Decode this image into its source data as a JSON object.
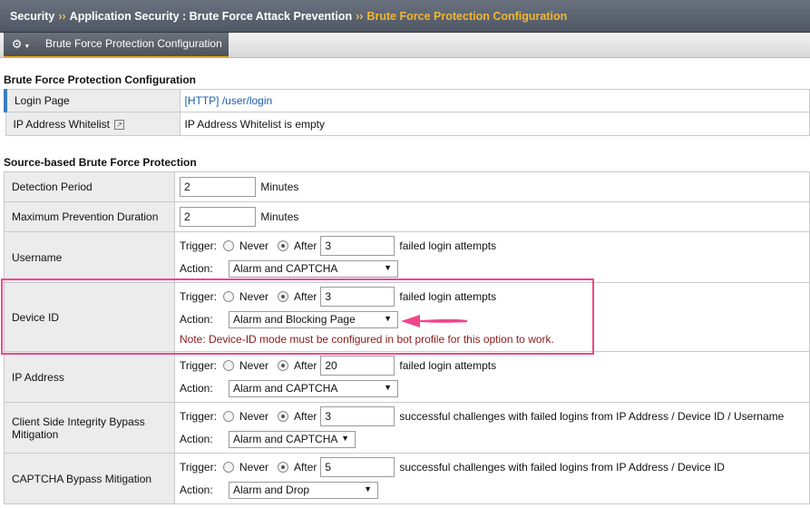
{
  "breadcrumb": {
    "items": [
      "Security",
      "Application Security : Brute Force Attack Prevention",
      "Brute Force Protection Configuration"
    ],
    "separator": "››"
  },
  "toolbar": {
    "gear_icon": "gear-icon",
    "active_tab": "Brute Force Protection Configuration"
  },
  "config_section": {
    "title": "Brute Force Protection Configuration",
    "rows": [
      {
        "label": "Login Page",
        "value": "[HTTP] /user/login"
      },
      {
        "label": "IP Address Whitelist",
        "value": "IP Address Whitelist is empty"
      }
    ]
  },
  "source_section": {
    "title": "Source-based Brute Force Protection",
    "detection_period": {
      "label": "Detection Period",
      "value": "2",
      "unit": "Minutes"
    },
    "max_prevention": {
      "label": "Maximum Prevention Duration",
      "value": "2",
      "unit": "Minutes"
    },
    "trigger_label": "Trigger:",
    "action_label": "Action:",
    "never_label": "Never",
    "after_label": "After",
    "username": {
      "label": "Username",
      "count": "3",
      "suffix": "failed login attempts",
      "action": "Alarm and CAPTCHA"
    },
    "device_id": {
      "label": "Device ID",
      "count": "3",
      "suffix": "failed login attempts",
      "action": "Alarm and Blocking Page",
      "note": "Note: Device-ID mode must be configured in bot profile for this option to work."
    },
    "ip_address": {
      "label": "IP Address",
      "count": "20",
      "suffix": "failed login attempts",
      "action": "Alarm and CAPTCHA"
    },
    "client_side": {
      "label": "Client Side Integrity Bypass Mitigation",
      "count": "3",
      "suffix": "successful challenges with failed logins from IP Address / Device ID / Username",
      "action": "Alarm and CAPTCHA"
    },
    "captcha_bypass": {
      "label": "CAPTCHA Bypass Mitigation",
      "count": "5",
      "suffix": "successful challenges with failed logins from IP Address / Device ID",
      "action": "Alarm and Drop"
    }
  },
  "colors": {
    "accent": "#f2a516",
    "highlight": "#f0468a",
    "link": "#1a5fa8",
    "note": "#8b1a1a"
  }
}
